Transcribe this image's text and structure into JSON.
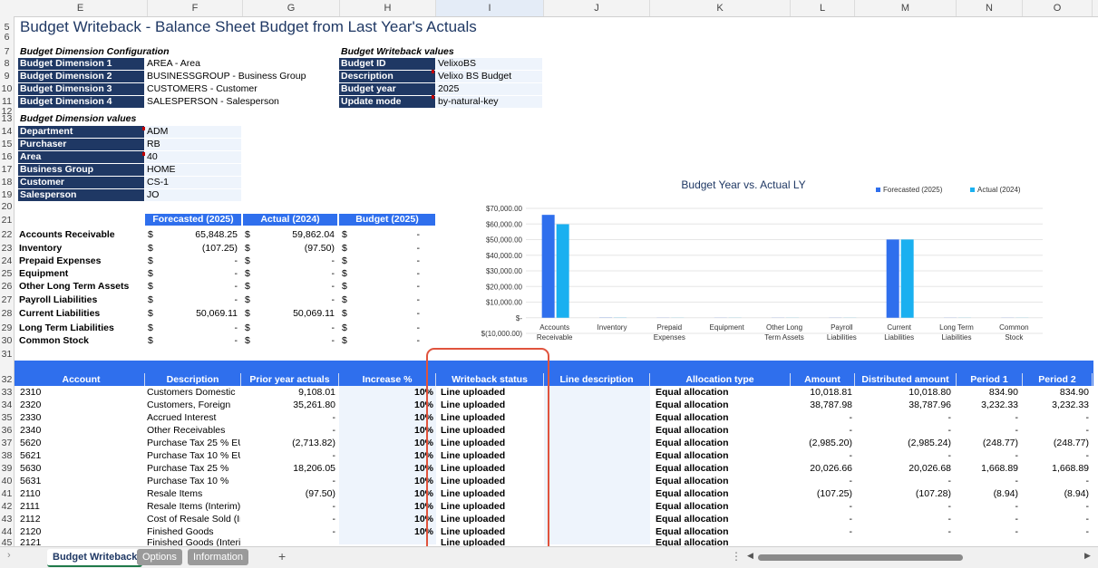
{
  "columns": [
    "E",
    "F",
    "G",
    "H",
    "I",
    "J",
    "K",
    "L",
    "M",
    "N",
    "O"
  ],
  "rows": [
    "5",
    "6",
    "7",
    "8",
    "9",
    "10",
    "11",
    "12",
    "13",
    "14",
    "15",
    "16",
    "17",
    "18",
    "19",
    "20",
    "21",
    "22",
    "23",
    "24",
    "25",
    "26",
    "27",
    "28",
    "29",
    "30",
    "31",
    "32",
    "33",
    "34",
    "35",
    "36",
    "37",
    "38",
    "39",
    "40",
    "41",
    "42",
    "43",
    "44",
    "45"
  ],
  "title": "Budget Writeback - Balance Sheet Budget from Last Year's Actuals",
  "dim_config": {
    "heading": "Budget Dimension Configuration",
    "items": [
      {
        "label": "Budget Dimension 1",
        "value": "AREA - Area"
      },
      {
        "label": "Budget Dimension 2",
        "value": "BUSINESSGROUP - Business Group"
      },
      {
        "label": "Budget Dimension 3",
        "value": "CUSTOMERS - Customer"
      },
      {
        "label": "Budget Dimension 4",
        "value": "SALESPERSON - Salesperson"
      }
    ]
  },
  "writeback_values": {
    "heading": "Budget Writeback values",
    "items": [
      {
        "label": "Budget ID",
        "value": "VelixoBS"
      },
      {
        "label": "Description",
        "value": "Velixo BS Budget"
      },
      {
        "label": "Budget year",
        "value": "2025"
      },
      {
        "label": "Update mode",
        "value": "by-natural-key"
      }
    ]
  },
  "dim_values": {
    "heading": "Budget Dimension values",
    "items": [
      {
        "label": "Department",
        "value": "ADM"
      },
      {
        "label": "Purchaser",
        "value": "RB"
      },
      {
        "label": "Area",
        "value": "40"
      },
      {
        "label": "Business Group",
        "value": "HOME"
      },
      {
        "label": "Customer",
        "value": "CS-1"
      },
      {
        "label": "Salesperson",
        "value": "JO"
      }
    ]
  },
  "summary": {
    "headers": [
      "Forecasted (2025)",
      "Actual (2024)",
      "Budget (2025)"
    ],
    "currency": "$",
    "rows": [
      {
        "label": "Accounts Receivable",
        "f": "65,848.25",
        "a": "59,862.04",
        "b": "-"
      },
      {
        "label": "Inventory",
        "f": "(107.25)",
        "a": "(97.50)",
        "b": "-"
      },
      {
        "label": "Prepaid Expenses",
        "f": "-",
        "a": "-",
        "b": "-"
      },
      {
        "label": "Equipment",
        "f": "-",
        "a": "-",
        "b": "-"
      },
      {
        "label": "Other Long Term Assets",
        "f": "-",
        "a": "-",
        "b": "-"
      },
      {
        "label": "Payroll Liabilities",
        "f": "-",
        "a": "-",
        "b": "-"
      },
      {
        "label": "Current Liabilities",
        "f": "50,069.11",
        "a": "50,069.11",
        "b": "-"
      },
      {
        "label": "Long Term Liabilities",
        "f": "-",
        "a": "-",
        "b": "-"
      },
      {
        "label": "Common Stock",
        "f": "-",
        "a": "-",
        "b": "-"
      }
    ]
  },
  "chart_data": {
    "type": "bar",
    "title": "Budget Year vs. Actual LY",
    "categories": [
      "Accounts Receivable",
      "Inventory",
      "Prepaid Expenses",
      "Equipment",
      "Other Long Term Assets",
      "Payroll Liabilities",
      "Current Liabilities",
      "Long Term Liabilities",
      "Common Stock"
    ],
    "series": [
      {
        "name": "Forecasted (2025)",
        "color": "#2f6fed",
        "values": [
          65848.25,
          -107.25,
          0,
          0,
          0,
          0,
          50069.11,
          0,
          0
        ]
      },
      {
        "name": "Actual (2024)",
        "color": "#1ab0f0",
        "values": [
          59862.04,
          -97.5,
          0,
          0,
          0,
          0,
          50069.11,
          0,
          0
        ]
      }
    ],
    "y_ticks": [
      "$70,000.00",
      "$60,000.00",
      "$50,000.00",
      "$40,000.00",
      "$30,000.00",
      "$20,000.00",
      "$10,000.00",
      "$-",
      "$(10,000.00)"
    ],
    "ylim": [
      -10000,
      70000
    ],
    "legend_position": "top-right",
    "grid": true
  },
  "table": {
    "headers": [
      "Account",
      "Description",
      "Prior year actuals",
      "Increase %",
      "Writeback status",
      "Line description",
      "Allocation type",
      "Amount",
      "Distributed amount",
      "Period 1",
      "Period 2"
    ],
    "rows": [
      {
        "acct": "2310",
        "desc": "Customers Domestic",
        "prior": "9,108.01",
        "inc": "10%",
        "status": "Line uploaded",
        "alloc": "Equal allocation",
        "amt": "10,018.81",
        "dist": "10,018.80",
        "p1": "834.90",
        "p2": "834.90"
      },
      {
        "acct": "2320",
        "desc": "Customers, Foreign",
        "prior": "35,261.80",
        "inc": "10%",
        "status": "Line uploaded",
        "alloc": "Equal allocation",
        "amt": "38,787.98",
        "dist": "38,787.96",
        "p1": "3,232.33",
        "p2": "3,232.33"
      },
      {
        "acct": "2330",
        "desc": "Accrued Interest",
        "prior": "-",
        "inc": "10%",
        "status": "Line uploaded",
        "alloc": "Equal allocation",
        "amt": "-",
        "dist": "-",
        "p1": "-",
        "p2": "-"
      },
      {
        "acct": "2340",
        "desc": "Other Receivables",
        "prior": "-",
        "inc": "10%",
        "status": "Line uploaded",
        "alloc": "Equal allocation",
        "amt": "-",
        "dist": "-",
        "p1": "-",
        "p2": "-"
      },
      {
        "acct": "5620",
        "desc": "Purchase Tax 25 % EU",
        "prior": "(2,713.82)",
        "inc": "10%",
        "status": "Line uploaded",
        "alloc": "Equal allocation",
        "amt": "(2,985.20)",
        "dist": "(2,985.24)",
        "p1": "(248.77)",
        "p2": "(248.77)"
      },
      {
        "acct": "5621",
        "desc": "Purchase Tax 10 % EU",
        "prior": "-",
        "inc": "10%",
        "status": "Line uploaded",
        "alloc": "Equal allocation",
        "amt": "-",
        "dist": "-",
        "p1": "-",
        "p2": "-"
      },
      {
        "acct": "5630",
        "desc": "Purchase Tax 25 %",
        "prior": "18,206.05",
        "inc": "10%",
        "status": "Line uploaded",
        "alloc": "Equal allocation",
        "amt": "20,026.66",
        "dist": "20,026.68",
        "p1": "1,668.89",
        "p2": "1,668.89"
      },
      {
        "acct": "5631",
        "desc": "Purchase Tax 10 %",
        "prior": "-",
        "inc": "10%",
        "status": "Line uploaded",
        "alloc": "Equal allocation",
        "amt": "-",
        "dist": "-",
        "p1": "-",
        "p2": "-"
      },
      {
        "acct": "2110",
        "desc": "Resale Items",
        "prior": "(97.50)",
        "inc": "10%",
        "status": "Line uploaded",
        "alloc": "Equal allocation",
        "amt": "(107.25)",
        "dist": "(107.28)",
        "p1": "(8.94)",
        "p2": "(8.94)"
      },
      {
        "acct": "2111",
        "desc": "Resale Items (Interim)",
        "prior": "-",
        "inc": "10%",
        "status": "Line uploaded",
        "alloc": "Equal allocation",
        "amt": "-",
        "dist": "-",
        "p1": "-",
        "p2": "-"
      },
      {
        "acct": "2112",
        "desc": "Cost of Resale Sold (In",
        "prior": "-",
        "inc": "10%",
        "status": "Line uploaded",
        "alloc": "Equal allocation",
        "amt": "-",
        "dist": "-",
        "p1": "-",
        "p2": "-"
      },
      {
        "acct": "2120",
        "desc": "Finished Goods",
        "prior": "-",
        "inc": "10%",
        "status": "Line uploaded",
        "alloc": "Equal allocation",
        "amt": "-",
        "dist": "-",
        "p1": "-",
        "p2": "-"
      },
      {
        "acct": "2121",
        "desc": "Finished Goods (Interi",
        "prior": "",
        "inc": "",
        "status": "Line uploaded",
        "alloc": "Equal allocation",
        "amt": "",
        "dist": "",
        "p1": "",
        "p2": ""
      }
    ]
  },
  "tabs": [
    "Budget Writeback",
    "Options",
    "Information"
  ],
  "add_sheet": "+",
  "highlight_color": "#e0533d"
}
